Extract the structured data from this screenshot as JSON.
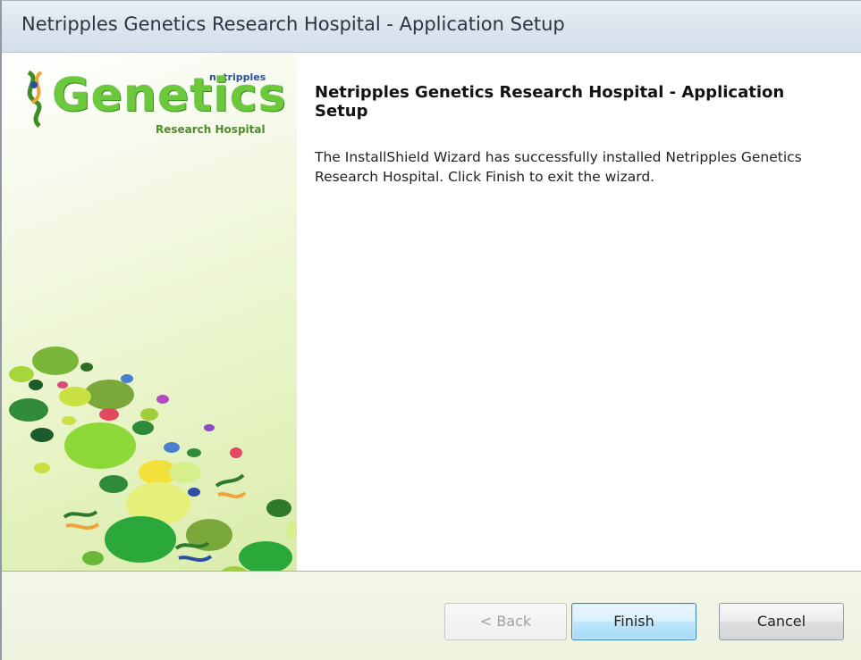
{
  "window": {
    "title": "Netripples Genetics Research Hospital - Application Setup"
  },
  "banner": {
    "logo_brand": "netripples",
    "logo_main": "Genetics",
    "logo_sub": "Research Hospital",
    "colors": {
      "green": "#6dc93c",
      "blue": "#2d4fa3",
      "dark_green": "#3c8d22"
    }
  },
  "content": {
    "heading": "Netripples Genetics Research Hospital - Application Setup",
    "message": "The InstallShield Wizard has successfully installed Netripples Genetics Research Hospital.  Click Finish to exit the wizard."
  },
  "buttons": {
    "back": "< Back",
    "finish": "Finish",
    "cancel": "Cancel"
  }
}
